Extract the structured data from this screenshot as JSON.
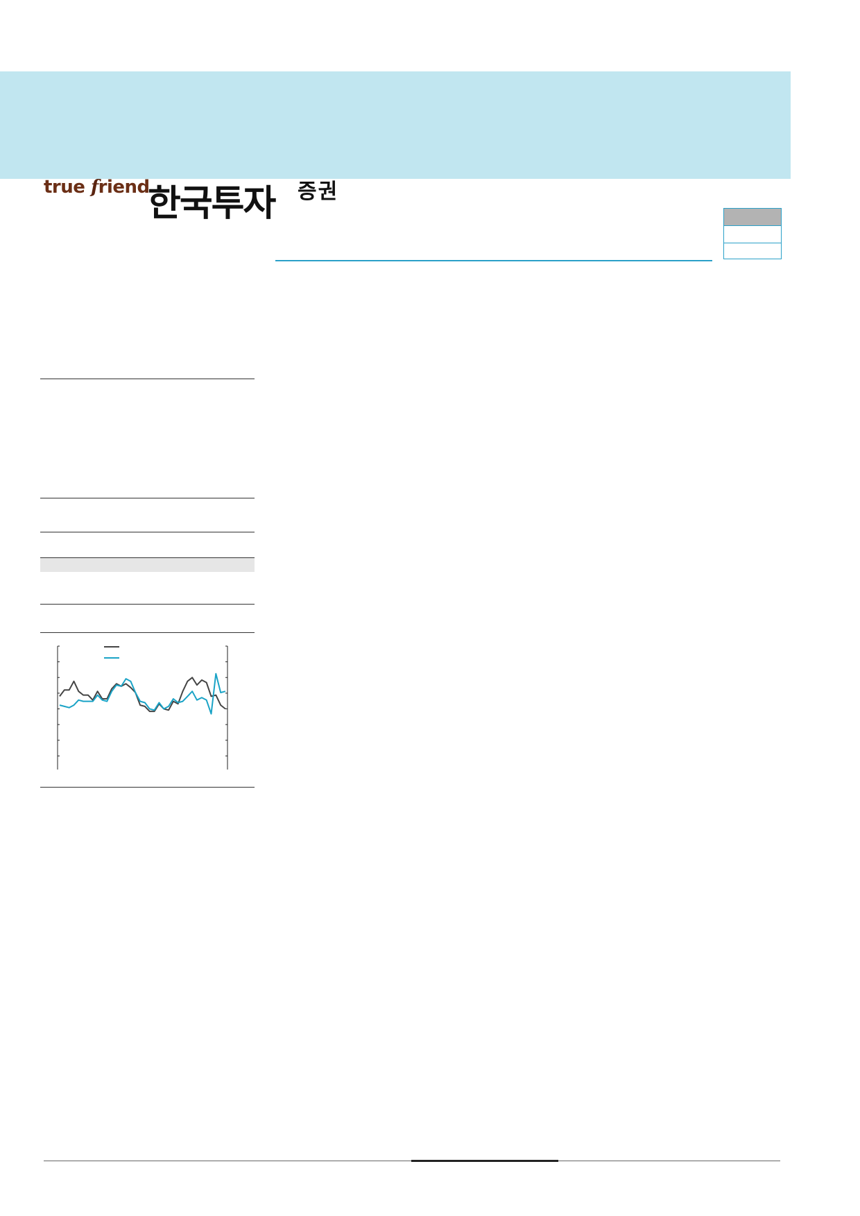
{
  "brand": {
    "logo_en_prefix": "true ",
    "logo_en_mark": "f",
    "logo_en_suffix": "riend",
    "logo_ko": "한국투자",
    "logo_ko_sub": "증권",
    "colors": {
      "header_band": "#c1e6f0",
      "logo_en": "#6b2f16",
      "accent": "#2aa0c8"
    }
  },
  "chart_data": {
    "type": "line",
    "ylim": [
      0,
      100
    ],
    "x_ticks": 3,
    "series": [
      {
        "color": "#444444",
        "values": [
          60,
          65,
          65,
          72,
          64,
          61,
          61,
          57,
          64,
          58,
          58,
          66,
          70,
          68,
          70,
          67,
          63,
          53,
          52,
          48,
          48,
          54,
          50,
          49,
          56,
          54,
          64,
          72,
          75,
          69,
          73,
          71,
          60,
          61,
          53,
          50
        ]
      },
      {
        "color": "#1aa3c6",
        "values": [
          53,
          52,
          51,
          53,
          57,
          56,
          56,
          56,
          61,
          57,
          56,
          64,
          69,
          68,
          74,
          72,
          63,
          56,
          55,
          50,
          49,
          55,
          50,
          52,
          58,
          55,
          56,
          60,
          64,
          57,
          59,
          57,
          46,
          78,
          63,
          64
        ]
      }
    ]
  }
}
